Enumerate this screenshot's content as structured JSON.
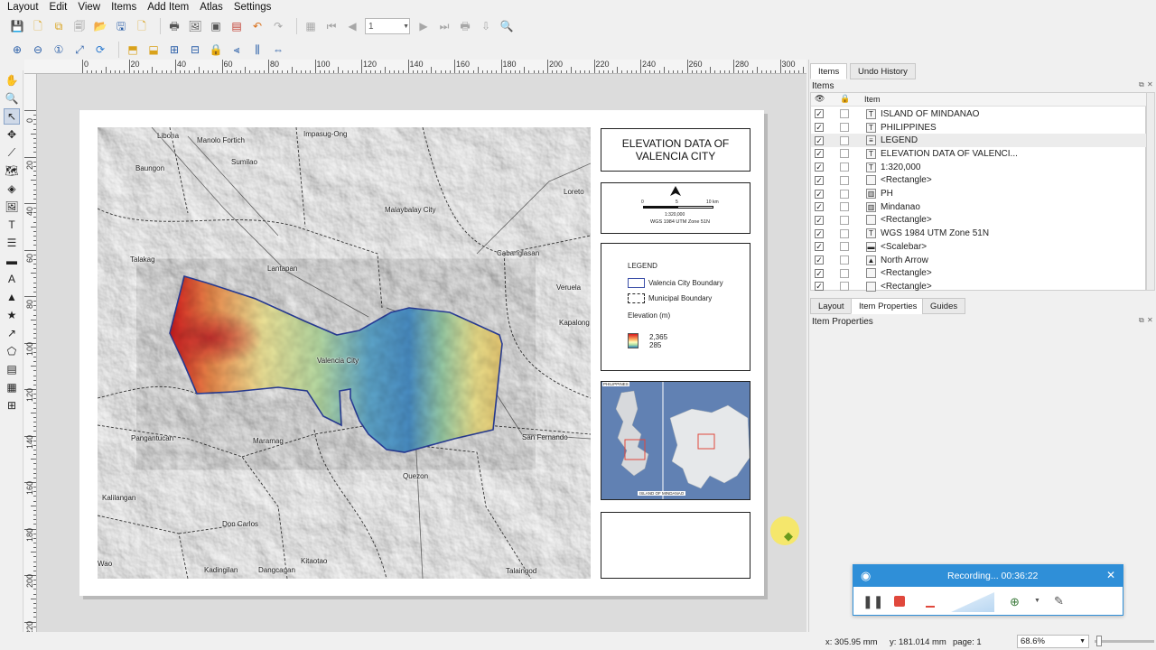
{
  "menubar": {
    "items": [
      "Layout",
      "Edit",
      "View",
      "Items",
      "Add Item",
      "Atlas",
      "Settings"
    ]
  },
  "toolbar": {
    "page_field_value": "1"
  },
  "ruler": {
    "h_labels": [
      "0",
      "20",
      "40",
      "60",
      "80",
      "100",
      "120",
      "140",
      "160",
      "180",
      "200",
      "220",
      "240",
      "260",
      "280",
      "300"
    ],
    "v_labels": [
      "0",
      "20",
      "40",
      "60",
      "80",
      "100",
      "120",
      "140",
      "160",
      "180",
      "200",
      "220"
    ]
  },
  "map": {
    "places": [
      "Libona",
      "Manolo Fortich",
      "Impasug-Ong",
      "Sumilao",
      "Baungon",
      "Loreto",
      "Malaybalay City",
      "Cabanglasan",
      "Talakag",
      "Lantapan",
      "Veruela",
      "Kapalong",
      "Valencia City",
      "Pangantucan",
      "Maramag",
      "San Fernando",
      "Kalilangan",
      "Quezon",
      "Don Carlos",
      "Kitaotao",
      "Wao",
      "Kadingilan",
      "Dangcagan",
      "Talaingod"
    ]
  },
  "layout": {
    "title": "ELEVATION DATA OF\nVALENCIA CITY",
    "scalebar": {
      "tick_0": "0",
      "tick_mid": "5",
      "tick_end": "10 km",
      "scale": "1:320,000",
      "crs": "WGS 1984 UTM Zone 51N"
    },
    "legend": {
      "title": "LEGEND",
      "boundary": "Valencia City Boundary",
      "municipal": "Municipal Boundary",
      "elevation_title": "Elevation (m)",
      "elev_high": "2,365",
      "elev_low": "285"
    },
    "inset": {
      "philippines_label": "PHILIPPINES",
      "mindanao_label": "ISLAND OF MINDANAO"
    }
  },
  "dock": {
    "tabs_top": [
      "Items",
      "Undo History"
    ],
    "items_header": "Items",
    "column_item": "Item",
    "items": [
      {
        "label": "ISLAND OF MINDANAO",
        "icon": "T"
      },
      {
        "label": "PHILIPPINES",
        "icon": "T"
      },
      {
        "label": "LEGEND",
        "icon": "≡"
      },
      {
        "label": "ELEVATION DATA OF VALENCI...",
        "icon": "T"
      },
      {
        "label": "1:320,000",
        "icon": "T"
      },
      {
        "label": "<Rectangle>",
        "icon": ""
      },
      {
        "label": "PH",
        "icon": "▥"
      },
      {
        "label": "Mindanao",
        "icon": "▥"
      },
      {
        "label": "<Rectangle>",
        "icon": ""
      },
      {
        "label": "WGS 1984 UTM Zone 51N",
        "icon": "T"
      },
      {
        "label": "<Scalebar>",
        "icon": "▬"
      },
      {
        "label": "North Arrow",
        "icon": "▲"
      },
      {
        "label": "<Rectangle>",
        "icon": ""
      },
      {
        "label": "<Rectangle>",
        "icon": ""
      }
    ],
    "tabs_bottom": [
      "Layout",
      "Item Properties",
      "Guides"
    ],
    "item_properties_header": "Item Properties"
  },
  "statusbar": {
    "x": "x: 305.95 mm",
    "y": "y: 181.014 mm",
    "page": "page: 1",
    "zoom": "68.6%"
  },
  "recorder": {
    "status": "Recording... 00:36:22"
  },
  "colors": {
    "accent": "#2f8fd8",
    "record_red": "#e0483c",
    "boundary_blue": "#2a3f9e"
  }
}
